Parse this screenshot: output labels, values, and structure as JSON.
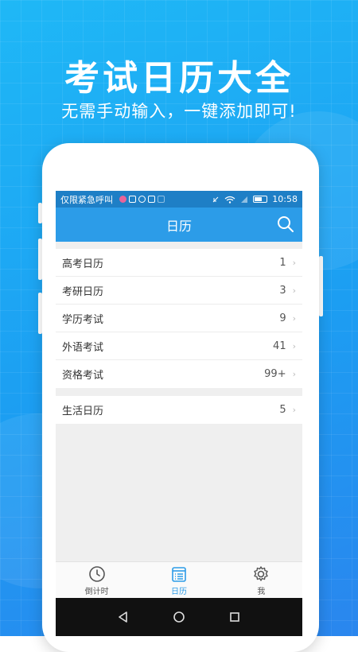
{
  "promo": {
    "headline": "考试日历大全",
    "subheadline": "无需手动输入，一键添加即可!"
  },
  "status_bar": {
    "carrier": "仅限紧急呼叫",
    "time": "10:58"
  },
  "app_bar": {
    "title": "日历",
    "search_icon": "search-icon"
  },
  "calendar_groups": [
    {
      "items": [
        {
          "label": "高考日历",
          "count": "1"
        },
        {
          "label": "考研日历",
          "count": "3"
        },
        {
          "label": "学历考试",
          "count": "9"
        },
        {
          "label": "外语考试",
          "count": "41"
        },
        {
          "label": "资格考试",
          "count": "99+"
        }
      ]
    },
    {
      "items": [
        {
          "label": "生活日历",
          "count": "5"
        }
      ]
    }
  ],
  "tab_bar": {
    "tabs": [
      {
        "label": "倒计时",
        "icon": "clock-icon",
        "active": false
      },
      {
        "label": "日历",
        "icon": "calendar-list-icon",
        "active": true
      },
      {
        "label": "我",
        "icon": "gear-icon",
        "active": false
      }
    ]
  },
  "colors": {
    "accent": "#2c9ce8",
    "status_bar": "#1e7fc6",
    "background_gradient_start": "#1fb8f6",
    "background_gradient_end": "#2a86ee"
  }
}
